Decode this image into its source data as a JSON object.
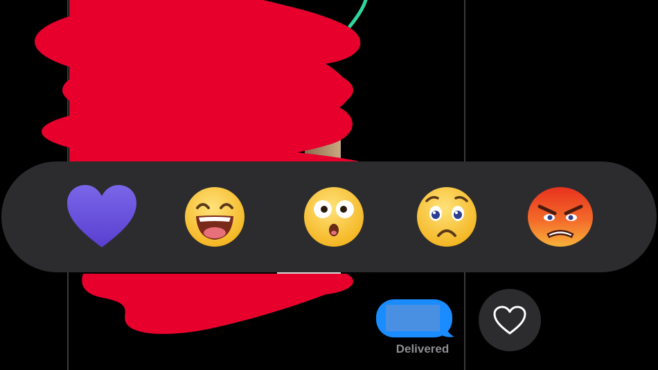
{
  "status": {
    "delivered_label": "Delivered"
  },
  "reactions": [
    {
      "name": "heart",
      "icon": "purple-heart-icon"
    },
    {
      "name": "laugh",
      "icon": "laughing-face-icon"
    },
    {
      "name": "wow",
      "icon": "surprised-face-icon"
    },
    {
      "name": "sad",
      "icon": "sad-face-icon"
    },
    {
      "name": "angry",
      "icon": "angry-face-icon"
    }
  ],
  "colors": {
    "background": "#000000",
    "reaction_bar": "#2c2c2e",
    "bubble": "#1a8cff",
    "redaction": "#e8002d",
    "heart": "#6b52d9",
    "delivered_text": "#8e8e93"
  },
  "add_reaction_button": {
    "icon": "heart-outline-icon"
  }
}
